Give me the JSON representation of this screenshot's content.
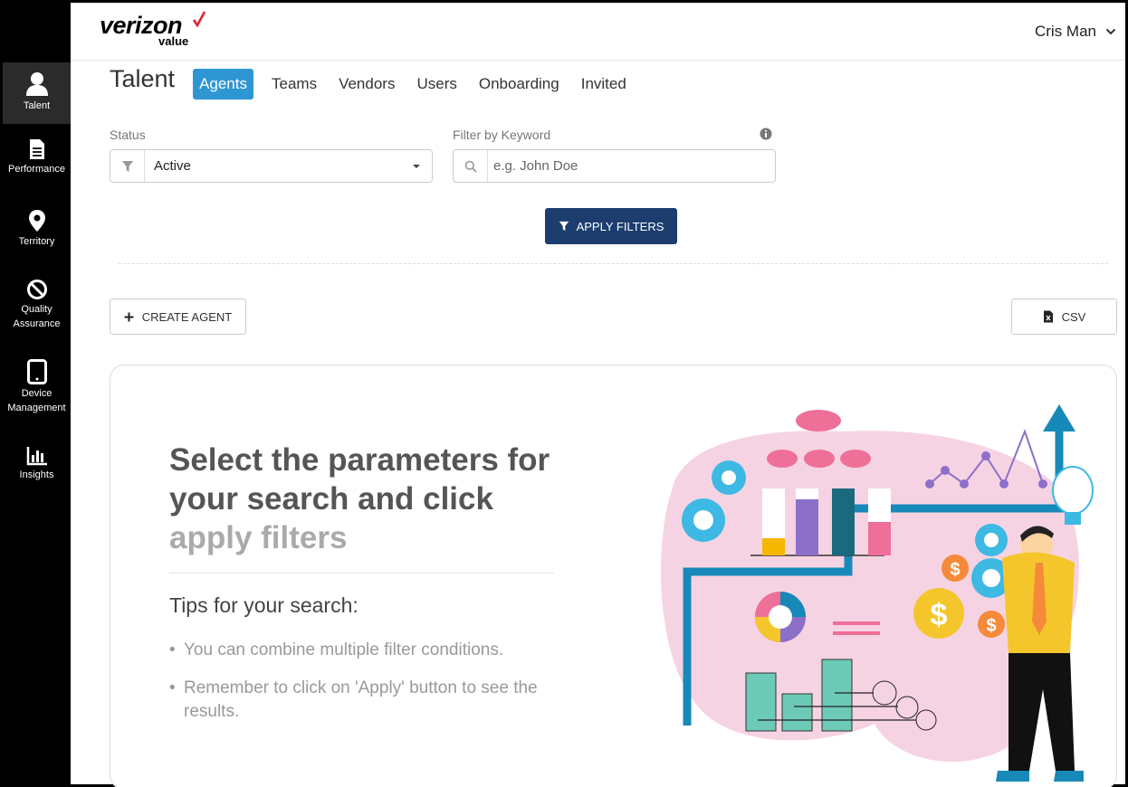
{
  "sidebar": {
    "items": [
      {
        "label": "Talent",
        "icon": "user-icon",
        "active": true
      },
      {
        "label": "Performance",
        "icon": "document-icon"
      },
      {
        "label": "Territory",
        "icon": "map-pin-icon"
      },
      {
        "label_line1": "Quality",
        "label_line2": "Assurance",
        "icon": "ban-icon"
      },
      {
        "label_line1": "Device",
        "label_line2": "Management",
        "icon": "tablet-icon"
      },
      {
        "label": "Insights",
        "icon": "bar-chart-icon"
      }
    ]
  },
  "header": {
    "brand": "verizon",
    "brand_sub": "value",
    "user_name": "Cris Man"
  },
  "page": {
    "title": "Talent",
    "tabs": [
      {
        "label": "Agents",
        "active": true
      },
      {
        "label": "Teams"
      },
      {
        "label": "Vendors"
      },
      {
        "label": "Users"
      },
      {
        "label": "Onboarding"
      },
      {
        "label": "Invited"
      }
    ]
  },
  "filters": {
    "status_label": "Status",
    "status_value": "Active",
    "keyword_label": "Filter by Keyword",
    "keyword_placeholder": "e.g. John Doe",
    "apply_label": "APPLY FILTERS"
  },
  "actions": {
    "create_label": "CREATE AGENT",
    "csv_label": "CSV"
  },
  "empty_state": {
    "headline_dark": "Select the parameters for your search and click",
    "headline_light": "apply filters",
    "tips_title": "Tips for your search:",
    "tips": [
      "You can combine multiple filter conditions.",
      "Remember to click on 'Apply' button to see the results."
    ]
  },
  "colors": {
    "accent_blue": "#2f96d4",
    "primary_navy": "#1c3d6e",
    "brand_red": "#e0232e",
    "sidebar_bg": "#000000"
  }
}
